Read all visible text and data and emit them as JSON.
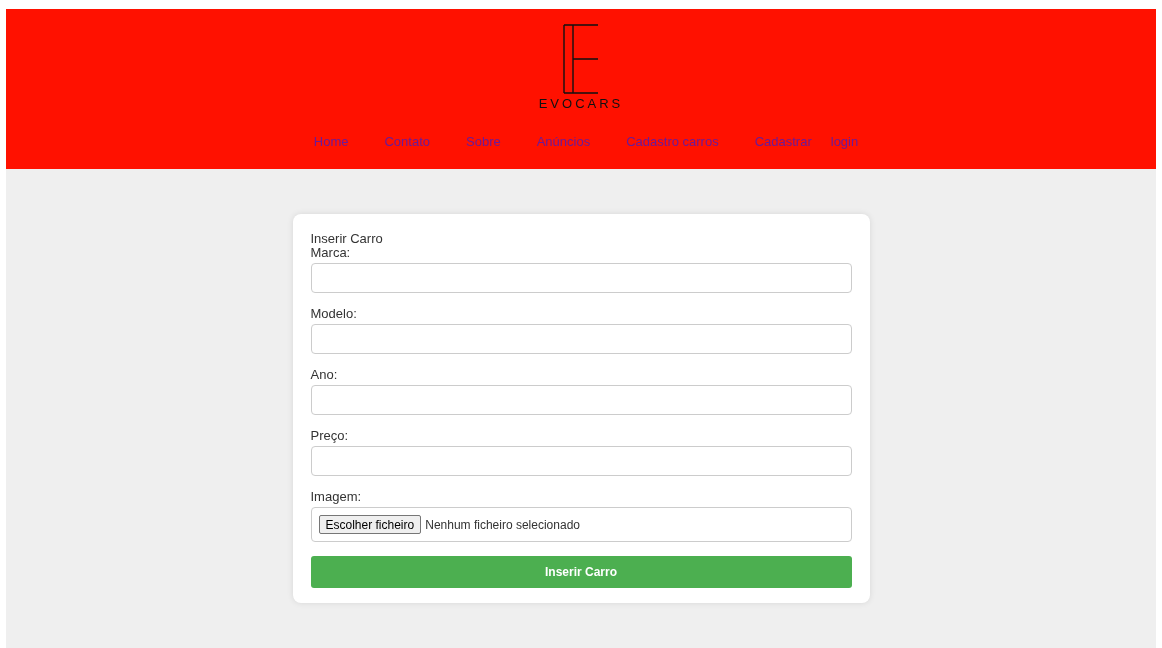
{
  "header": {
    "logo_text": "EVOCARS"
  },
  "nav": [
    "Home",
    "Contato",
    "Sobre",
    "Anúncios",
    "Cadastro carros",
    "Cadastrar",
    "login"
  ],
  "form": {
    "title": "Inserir Carro",
    "fields": [
      {
        "label": "Marca:",
        "kind": "text"
      },
      {
        "label": "Modelo:",
        "kind": "text"
      },
      {
        "label": "Ano:",
        "kind": "text"
      },
      {
        "label": "Preço:",
        "kind": "text"
      },
      {
        "label": "Imagem:",
        "kind": "file",
        "button": "Escolher ficheiro",
        "status": "Nenhum ficheiro selecionado"
      }
    ],
    "submit": "Inserir Carro"
  }
}
